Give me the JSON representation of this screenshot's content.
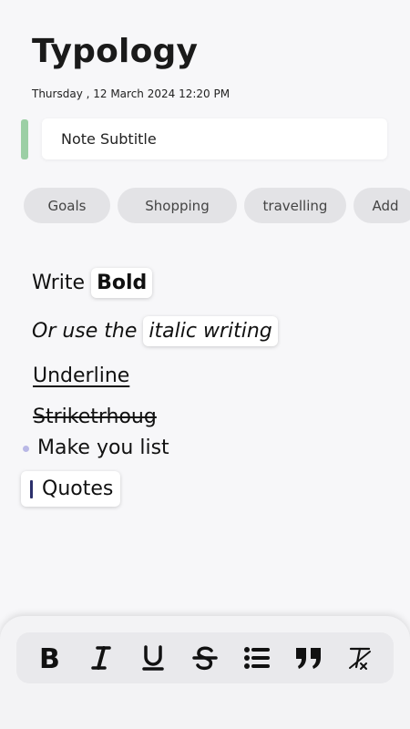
{
  "note": {
    "title": "Typology",
    "date": "Thursday , 12 March 2024 12:20 PM",
    "subtitle": "Note Subtitle"
  },
  "tags": [
    "Goals",
    "Shopping",
    "travelling",
    "Add"
  ],
  "content": {
    "line1_prefix": "Write",
    "line1_bold": "Bold",
    "line2_prefix": "Or use  the",
    "line2_italic": "italic writing",
    "underline": "Underline",
    "strike": "Striketrhoug",
    "list_item": "Make you list",
    "quote": "Quotes"
  },
  "toolbar": {
    "icons": [
      "bold-icon",
      "italic-icon",
      "underline-icon",
      "strikethrough-icon",
      "list-icon",
      "quote-icon",
      "clear-format-icon"
    ]
  },
  "colors": {
    "accent_green": "#9ccfa5",
    "bullet": "#b9b8e6",
    "quote_bar": "#2b2f6b"
  }
}
